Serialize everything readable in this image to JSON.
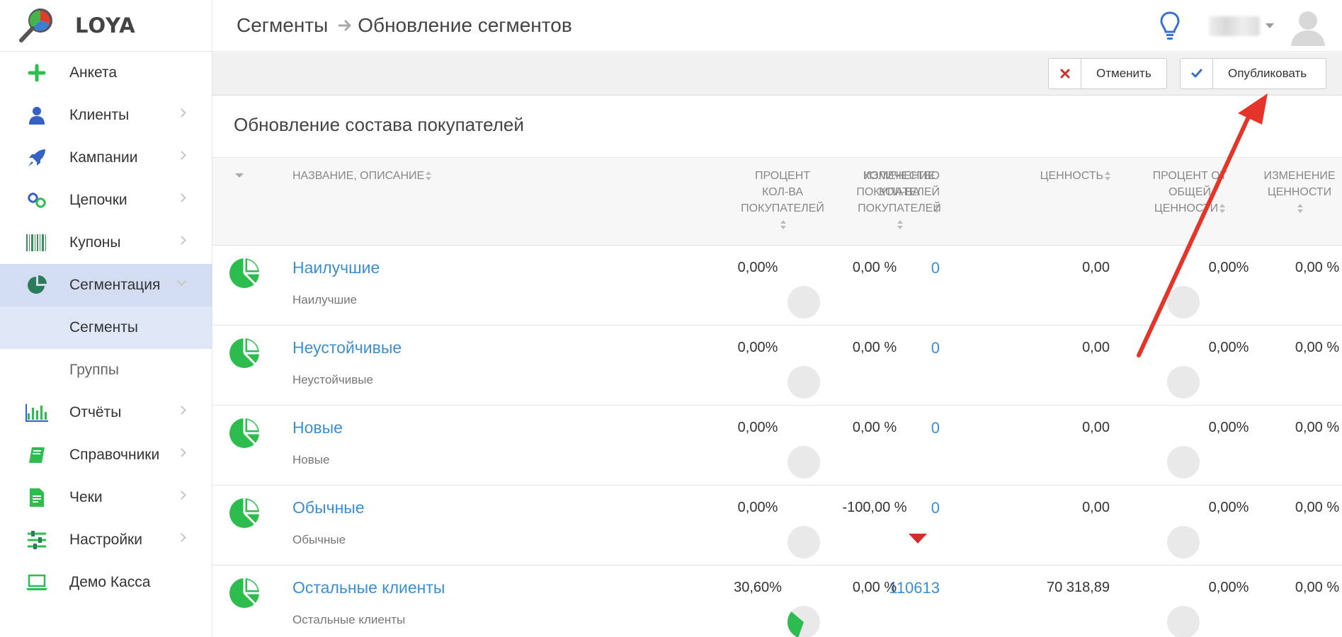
{
  "app": {
    "name": "LOYA"
  },
  "sidebar": {
    "items": [
      {
        "label": "Анкета",
        "icon": "plus-icon",
        "has_chevron": false
      },
      {
        "label": "Клиенты",
        "icon": "user-icon",
        "has_chevron": true
      },
      {
        "label": "Кампании",
        "icon": "rocket-icon",
        "has_chevron": true
      },
      {
        "label": "Цепочки",
        "icon": "link-icon",
        "has_chevron": true
      },
      {
        "label": "Купоны",
        "icon": "barcode-icon",
        "has_chevron": true
      },
      {
        "label": "Сегментация",
        "icon": "pie-icon",
        "has_chevron": true,
        "expanded": true
      },
      {
        "label": "Отчёты",
        "icon": "bar-chart-icon",
        "has_chevron": true
      },
      {
        "label": "Справочники",
        "icon": "book-icon",
        "has_chevron": true
      },
      {
        "label": "Чеки",
        "icon": "receipt-icon",
        "has_chevron": true
      },
      {
        "label": "Настройки",
        "icon": "sliders-icon",
        "has_chevron": true
      },
      {
        "label": "Демо Касса",
        "icon": "laptop-icon",
        "has_chevron": false
      }
    ],
    "sub_items": [
      {
        "label": "Сегменты",
        "active": true
      },
      {
        "label": "Группы",
        "active": false
      }
    ]
  },
  "header": {
    "breadcrumb": [
      "Сегменты",
      "Обновление сегментов"
    ]
  },
  "toolbar": {
    "cancel_label": "Отменить",
    "publish_label": "Опубликовать"
  },
  "page": {
    "section_title": "Обновление состава покупателей"
  },
  "table": {
    "columns": {
      "name": "НАЗВАНИЕ, ОПИСАНИЕ",
      "count": [
        "КОЛИЧЕСТВО",
        "ПОКУПАТЕЛЕЙ"
      ],
      "pct_count": [
        "ПРОЦЕНТ",
        "КОЛ-ВА",
        "ПОКУПАТЕЛЕЙ"
      ],
      "chg_count": [
        "ИЗМЕНЕНИЕ",
        "КОЛ-ВА",
        "ПОКУПАТЕЛЕЙ"
      ],
      "value": "ЦЕННОСТЬ",
      "pct_value": [
        "ПРОЦЕНТ ОТ",
        "ОБЩЕЙ",
        "ЦЕННОСТИ"
      ],
      "chg_value": [
        "ИЗМЕНЕНИЕ",
        "ЦЕННОСТИ"
      ]
    },
    "rows": [
      {
        "name": "Наилучшие",
        "desc": "Наилучшие",
        "count": "0",
        "pct_count": "0,00%",
        "chg_count": "0,00 %",
        "value": "0,00",
        "pct_value": "0,00%",
        "chg_value": "0,00 %",
        "share": 0,
        "trend": "none"
      },
      {
        "name": "Неустойчивые",
        "desc": "Неустойчивые",
        "count": "0",
        "pct_count": "0,00%",
        "chg_count": "0,00 %",
        "value": "0,00",
        "pct_value": "0,00%",
        "chg_value": "0,00 %",
        "share": 0,
        "trend": "none"
      },
      {
        "name": "Новые",
        "desc": "Новые",
        "count": "0",
        "pct_count": "0,00%",
        "chg_count": "0,00 %",
        "value": "0,00",
        "pct_value": "0,00%",
        "chg_value": "0,00 %",
        "share": 0,
        "trend": "none"
      },
      {
        "name": "Обычные",
        "desc": "Обычные",
        "count": "0",
        "pct_count": "0,00%",
        "chg_count": "-100,00 %",
        "value": "0,00",
        "pct_value": "0,00%",
        "chg_value": "0,00 %",
        "share": 0,
        "trend": "down"
      },
      {
        "name": "Остальные клиенты",
        "desc": "Остальные клиенты",
        "count": "110613",
        "pct_count": "30,60%",
        "chg_count": "0,00 %",
        "value": "70 318,89",
        "pct_value": "0,00%",
        "chg_value": "0,00 %",
        "share": 0.306,
        "trend": "none"
      }
    ]
  },
  "colors": {
    "accent_green": "#2dbd4e",
    "link_blue": "#3a8fd3",
    "active_nav": "#d3ddf1",
    "annotation_red": "#e5352b",
    "down_red": "#d0302d"
  }
}
